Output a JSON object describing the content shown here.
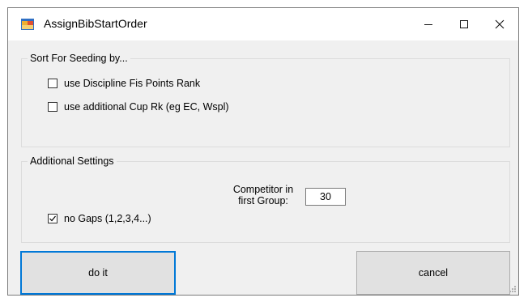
{
  "window": {
    "title": "AssignBibStartOrder",
    "controls": {
      "minimize": "minimize-icon",
      "maximize": "maximize-icon",
      "close": "close-icon"
    }
  },
  "sort_group": {
    "label": "Sort For Seeding by...",
    "options": [
      {
        "label": "use Discipline Fis Points Rank",
        "checked": false
      },
      {
        "label": "use additional Cup Rk (eg EC, Wspl)",
        "checked": false
      }
    ]
  },
  "settings_group": {
    "label": "Additional Settings",
    "competitor_label_line1": "Competitor in",
    "competitor_label_line2": "first Group:",
    "competitor_value": "30",
    "no_gaps": {
      "label": "no Gaps (1,2,3,4...)",
      "checked": true
    }
  },
  "buttons": {
    "do_it": "do it",
    "cancel": "cancel"
  },
  "colors": {
    "accent": "#0078d7",
    "dialog_bg": "#f0f0f0",
    "button_bg": "#e1e1e1"
  }
}
